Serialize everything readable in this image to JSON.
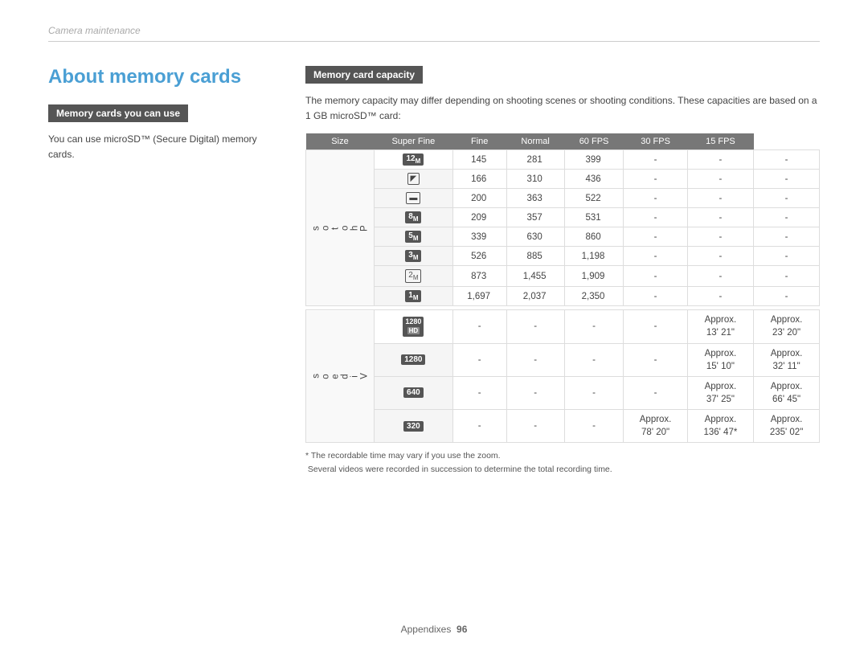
{
  "breadcrumb": "Camera maintenance",
  "page_title": "About memory cards",
  "left_section": {
    "header": "Memory cards you can use",
    "body": "You can use microSD™ (Secure Digital) memory cards."
  },
  "right_section": {
    "header": "Memory card capacity",
    "intro": "The memory capacity may differ depending on shooting scenes or shooting conditions. These capacities are based on a 1 GB microSD™ card:",
    "table": {
      "headers": [
        "Size",
        "Super Fine",
        "Fine",
        "Normal",
        "60 FPS",
        "30 FPS",
        "15 FPS"
      ],
      "photos_label": "P\nh\no\nt\no\ns",
      "videos_label": "V\ni\nd\ne\no\ns",
      "photo_rows": [
        {
          "icon": "12m",
          "icon_type": "dark",
          "sf": "145",
          "f": "281",
          "n": "399",
          "fps60": "-",
          "fps30": "-",
          "fps15": "-"
        },
        {
          "icon": "🔲",
          "icon_type": "outline-sq",
          "sf": "166",
          "f": "310",
          "n": "436",
          "fps60": "-",
          "fps30": "-",
          "fps15": "-"
        },
        {
          "icon": "🔲",
          "icon_type": "outline-rect",
          "sf": "200",
          "f": "363",
          "n": "522",
          "fps60": "-",
          "fps30": "-",
          "fps15": "-"
        },
        {
          "icon": "8m",
          "icon_type": "dark",
          "sf": "209",
          "f": "357",
          "n": "531",
          "fps60": "-",
          "fps30": "-",
          "fps15": "-"
        },
        {
          "icon": "5m",
          "icon_type": "dark",
          "sf": "339",
          "f": "630",
          "n": "860",
          "fps60": "-",
          "fps30": "-",
          "fps15": "-"
        },
        {
          "icon": "3m",
          "icon_type": "dark",
          "sf": "526",
          "f": "885",
          "n": "1,198",
          "fps60": "-",
          "fps30": "-",
          "fps15": "-"
        },
        {
          "icon": "2m",
          "icon_type": "outline",
          "sf": "873",
          "f": "1,455",
          "n": "1,909",
          "fps60": "-",
          "fps30": "-",
          "fps15": "-"
        },
        {
          "icon": "1m",
          "icon_type": "dark-sm",
          "sf": "1,697",
          "f": "2,037",
          "n": "2,350",
          "fps60": "-",
          "fps30": "-",
          "fps15": "-"
        }
      ],
      "video_rows": [
        {
          "icon": "1280 HD",
          "icon_type": "dark-hd",
          "sf": "-",
          "f": "-",
          "n": "-",
          "fps60": "-",
          "fps30": "Approx.\n13' 21\"",
          "fps15": "Approx.\n23' 20\""
        },
        {
          "icon": "1280",
          "icon_type": "dark",
          "sf": "-",
          "f": "-",
          "n": "-",
          "fps60": "-",
          "fps30": "Approx.\n15' 10\"",
          "fps15": "Approx.\n32' 11\""
        },
        {
          "icon": "640",
          "icon_type": "dark",
          "sf": "-",
          "f": "-",
          "n": "-",
          "fps60": "-",
          "fps30": "Approx.\n37' 25\"",
          "fps15": "Approx.\n66' 45\""
        },
        {
          "icon": "320",
          "icon_type": "dark",
          "sf": "-",
          "f": "-",
          "n": "Approx.\n78' 20\"",
          "fps60": "Approx.\n136' 47*",
          "fps30": "Approx.\n235' 02\"",
          "fps15": ""
        }
      ]
    },
    "footnotes": [
      "* The recordable time may vary if you use the zoom.",
      " Several videos were recorded in succession to determine the total recording time."
    ]
  },
  "footer": {
    "label": "Appendixes",
    "page_number": "96"
  }
}
